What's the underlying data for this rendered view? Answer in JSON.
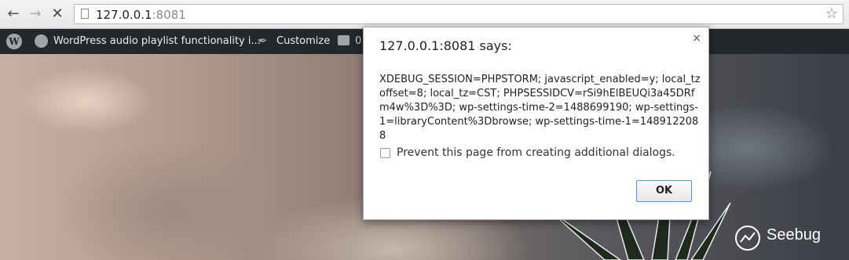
{
  "browser": {
    "url_host": "127.0.0.1",
    "url_port": ":8081"
  },
  "adminbar": {
    "site_name": "WordPress audio playlist functionality i...",
    "customize": "Customize",
    "comments": "0"
  },
  "dialog": {
    "title": "127.0.0.1:8081 says:",
    "close": "×",
    "message": "XDEBUG_SESSION=PHPSTORM; javascript_enabled=y; local_tzoffset=8; local_tz=CST; PHPSESSIDCV=rSi9hElBEUQi3a45DRfm4w%3D%3D; wp-settings-time-2=1488699190; wp-settings-1=libraryContent%3Dbrowse; wp-settings-time-1=1489122088",
    "checkbox_label": "Prevent this page from creating additional dialogs.",
    "ok_label": "OK"
  },
  "watermark": {
    "text": "Seebug"
  }
}
